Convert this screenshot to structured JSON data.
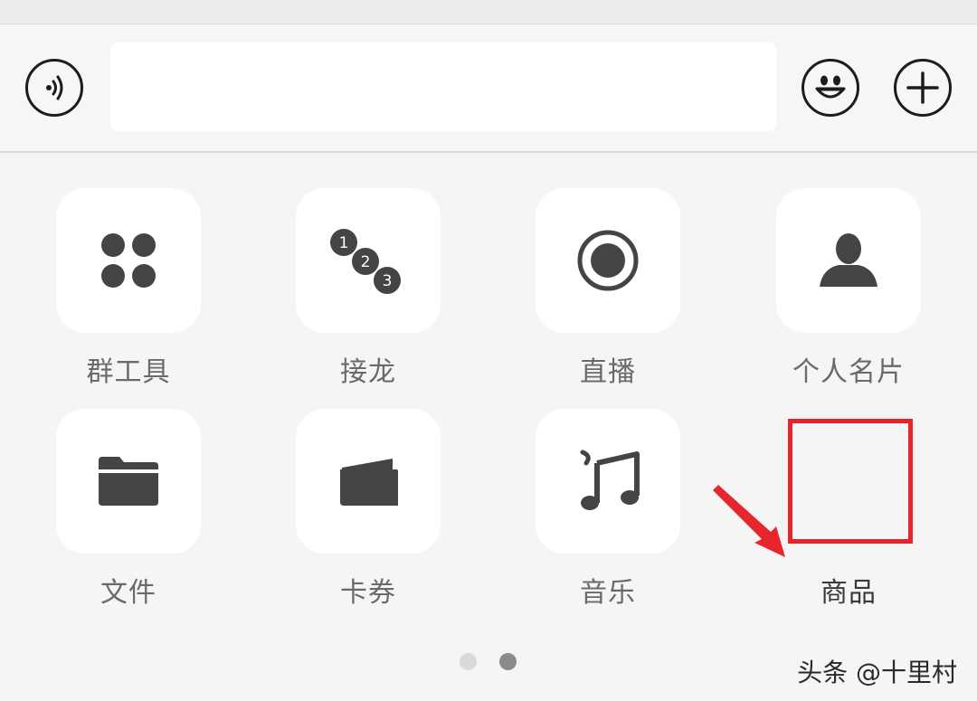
{
  "input_bar": {
    "voice_icon": "voice-icon",
    "emoji_icon": "smiley-icon",
    "plus_icon": "plus-icon",
    "text_value": ""
  },
  "grid": {
    "items": [
      {
        "label": "群工具",
        "icon": "group-tools-icon"
      },
      {
        "label": "接龙",
        "icon": "numbered-chain-icon"
      },
      {
        "label": "直播",
        "icon": "live-record-icon"
      },
      {
        "label": "个人名片",
        "icon": "person-icon"
      },
      {
        "label": "文件",
        "icon": "folder-icon"
      },
      {
        "label": "卡券",
        "icon": "wallet-card-icon"
      },
      {
        "label": "音乐",
        "icon": "music-note-icon"
      },
      {
        "label": "商品",
        "icon": ""
      }
    ]
  },
  "annotation": {
    "highlight_color": "#e6262b"
  },
  "pager": {
    "page_count": 2,
    "current_page": 2,
    "active_color": "#8a8a8a",
    "inactive_color": "#dadada"
  },
  "watermark": {
    "text": "头条 @十里村"
  },
  "colors": {
    "icon_dark": "#444444",
    "tile_bg": "#ffffff",
    "panel_bg": "#f5f5f5"
  }
}
